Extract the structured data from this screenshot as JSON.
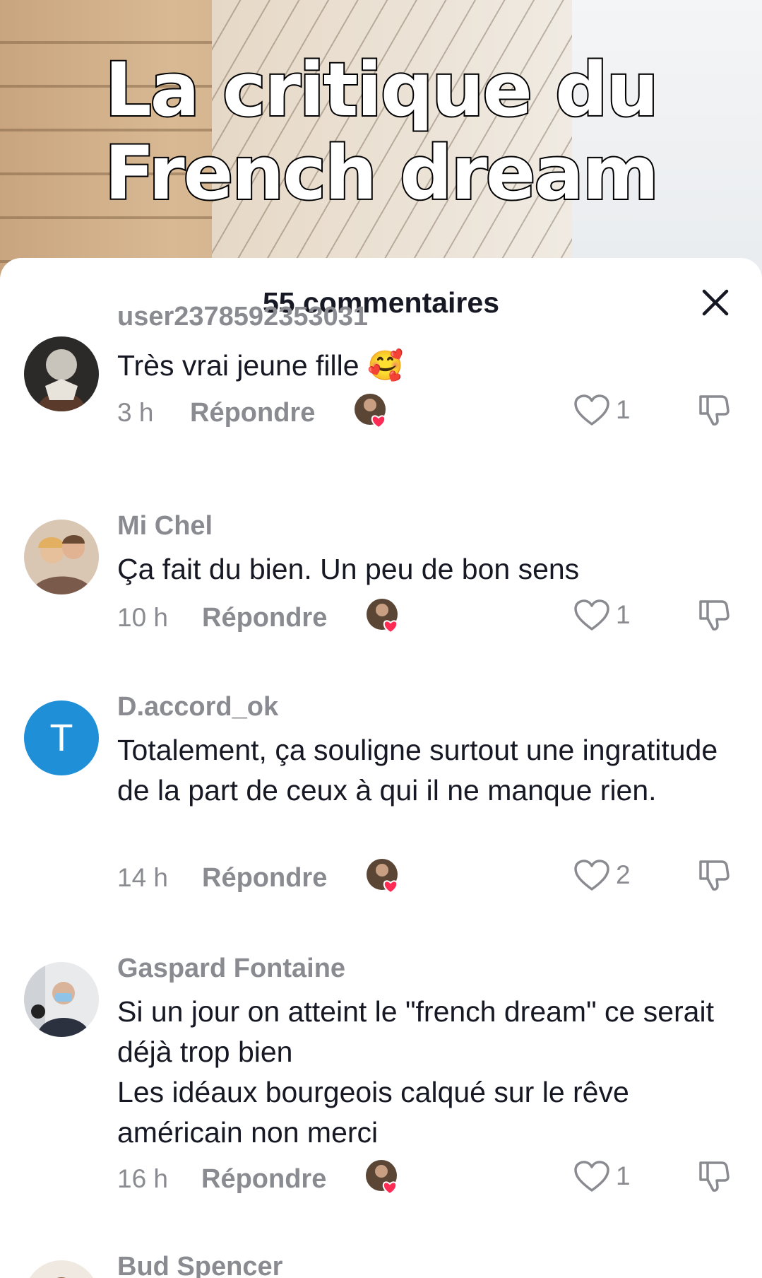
{
  "video": {
    "title_line1": "La critique du",
    "title_line2": "French dream"
  },
  "sheet": {
    "title": "55 commentaires"
  },
  "comments": [
    {
      "username": "user2378592353031",
      "text": "Très vrai jeune fille 🥰",
      "time": "3 h",
      "reply": "Répondre",
      "likes": "1"
    },
    {
      "username": "Mi Chel",
      "text": "Ça fait du bien. Un peu de bon sens",
      "time": "10 h",
      "reply": "Répondre",
      "likes": "1"
    },
    {
      "username": "D.accord_ok",
      "avatar_letter": "T",
      "text": "Totalement, ça souligne surtout une ingratitude de la part de ceux à qui il ne manque rien.",
      "time": "14 h",
      "reply": "Répondre",
      "likes": "2"
    },
    {
      "username": "Gaspard Fontaine",
      "text_line1": "Si un jour on atteint le \"french dream\" ce serait déjà trop bien",
      "text_line2": "Les idéaux bourgeois calqué sur le rêve américain non merci",
      "time": "16 h",
      "reply": "Répondre",
      "likes": "1"
    },
    {
      "username": "Bud Spencer"
    }
  ],
  "colors": {
    "heart_badge": "#fe2c55",
    "avatar_letter_bg": "#1f8fd8",
    "secondary_text": "#8a8b91"
  }
}
